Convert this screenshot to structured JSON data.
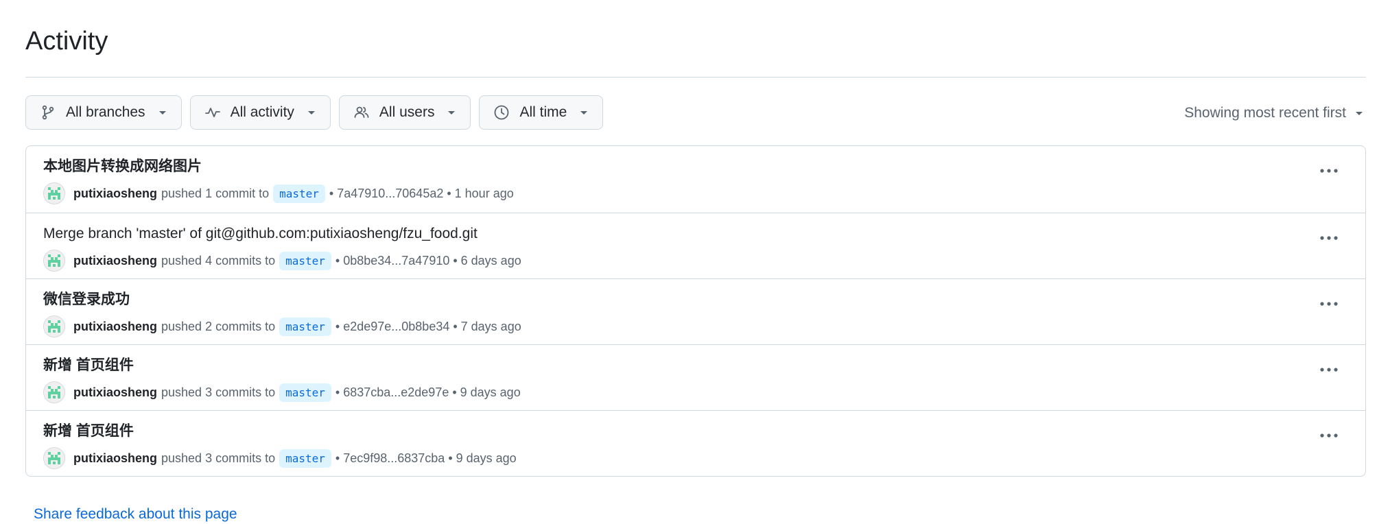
{
  "page": {
    "title": "Activity"
  },
  "filters": {
    "branches": "All branches",
    "activity": "All activity",
    "users": "All users",
    "time": "All time"
  },
  "sort": {
    "label": "Showing most recent first"
  },
  "activities": [
    {
      "title": "本地图片转换成网络图片",
      "user": "putixiaosheng",
      "action": "pushed 1 commit to",
      "branch": "master",
      "details": "• 7a47910...70645a2 • 1 hour ago"
    },
    {
      "title": "Merge branch 'master' of git@github.com:putixiaosheng/fzu_food.git",
      "user": "putixiaosheng",
      "action": "pushed 4 commits to",
      "branch": "master",
      "details": "• 0b8be34...7a47910 • 6 days ago"
    },
    {
      "title": "微信登录成功",
      "user": "putixiaosheng",
      "action": "pushed 2 commits to",
      "branch": "master",
      "details": "• e2de97e...0b8be34 • 7 days ago"
    },
    {
      "title": "新增 首页组件",
      "user": "putixiaosheng",
      "action": "pushed 3 commits to",
      "branch": "master",
      "details": "• 6837cba...e2de97e • 9 days ago"
    },
    {
      "title": "新增 首页组件",
      "user": "putixiaosheng",
      "action": "pushed 3 commits to",
      "branch": "master",
      "details": "• 7ec9f98...6837cba • 9 days ago"
    }
  ],
  "footer": {
    "feedback": "Share feedback about this page"
  },
  "colors": {
    "link": "#0969da",
    "branch_bg": "#ddf4ff",
    "border": "#d1d9e0",
    "muted": "#59636e",
    "avatar_green": "#5fd1a0"
  }
}
